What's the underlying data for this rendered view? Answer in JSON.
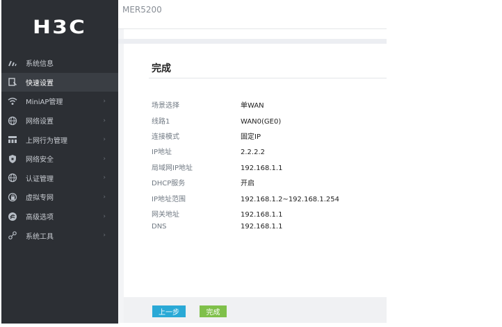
{
  "brand": {
    "logo_text": "H3C"
  },
  "header": {
    "device_name": "MER5200"
  },
  "sidebar": {
    "items": [
      {
        "label": "系统信息",
        "icon": "gauge-icon",
        "active": false,
        "has_children": false
      },
      {
        "label": "快速设置",
        "icon": "quick-setup-icon",
        "active": true,
        "has_children": false
      },
      {
        "label": "MiniAP管理",
        "icon": "wifi-icon",
        "active": false,
        "has_children": true
      },
      {
        "label": "网络设置",
        "icon": "globe-icon",
        "active": false,
        "has_children": true
      },
      {
        "label": "上网行为管理",
        "icon": "network-behavior-icon",
        "active": false,
        "has_children": true
      },
      {
        "label": "网络安全",
        "icon": "shield-icon",
        "active": false,
        "has_children": true
      },
      {
        "label": "认证管理",
        "icon": "globe-auth-icon",
        "active": false,
        "has_children": true
      },
      {
        "label": "虚拟专网",
        "icon": "vpn-icon",
        "active": false,
        "has_children": true
      },
      {
        "label": "高级选项",
        "icon": "advanced-icon",
        "active": false,
        "has_children": true
      },
      {
        "label": "系统工具",
        "icon": "tools-icon",
        "active": false,
        "has_children": true
      }
    ],
    "chevron_glyph": "›"
  },
  "main": {
    "title": "完成",
    "rows": [
      {
        "label": "场景选择",
        "value": "单WAN"
      },
      {
        "label": "线路1",
        "value": "WAN0(GE0)"
      },
      {
        "label": "连接模式",
        "value": "固定IP"
      },
      {
        "label": "IP地址",
        "value": "2.2.2.2"
      },
      {
        "label": "局域网IP地址",
        "value": "192.168.1.1"
      },
      {
        "label": "DHCP服务",
        "value": "开启"
      },
      {
        "label": "IP地址范围",
        "value": "192.168.1.2~192.168.1.254"
      },
      {
        "label": "网关地址",
        "value": "192.168.1.1"
      },
      {
        "label": "DNS",
        "value": "192.168.1.1"
      }
    ]
  },
  "footer": {
    "prev_label": "上一步",
    "finish_label": "完成"
  },
  "colors": {
    "sidebar_bg": "#2c2f34",
    "prev_button": "#2aa9d6",
    "finish_button": "#7fc04a"
  }
}
